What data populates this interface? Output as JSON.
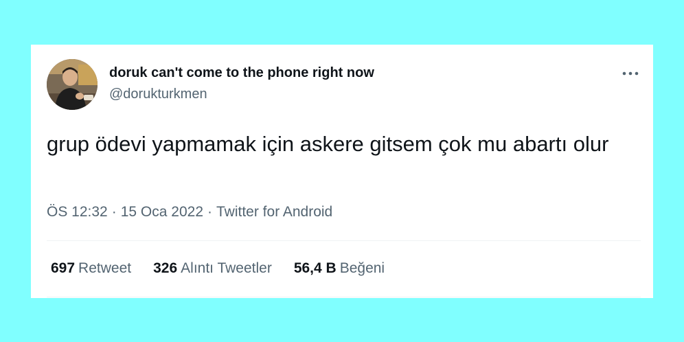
{
  "tweet": {
    "display_name": "doruk can't come to the phone right now",
    "handle": "@dorukturkmen",
    "text": "grup ödevi yapmamak için askere gitsem çok mu abartı olur",
    "time": "ÖS 12:32",
    "date": "15 Oca 2022",
    "source": "Twitter for Android",
    "more_icon": "more-horizontal-icon"
  },
  "stats": [
    {
      "value": "697",
      "label": "Retweet"
    },
    {
      "value": "326",
      "label": "Alıntı Tweetler"
    },
    {
      "value": "56,4 B",
      "label": "Beğeni"
    }
  ],
  "colors": {
    "background": "#80ffff",
    "card": "#ffffff",
    "primary_text": "#0f1419",
    "secondary_text": "#536471",
    "divider": "#eff3f4"
  }
}
